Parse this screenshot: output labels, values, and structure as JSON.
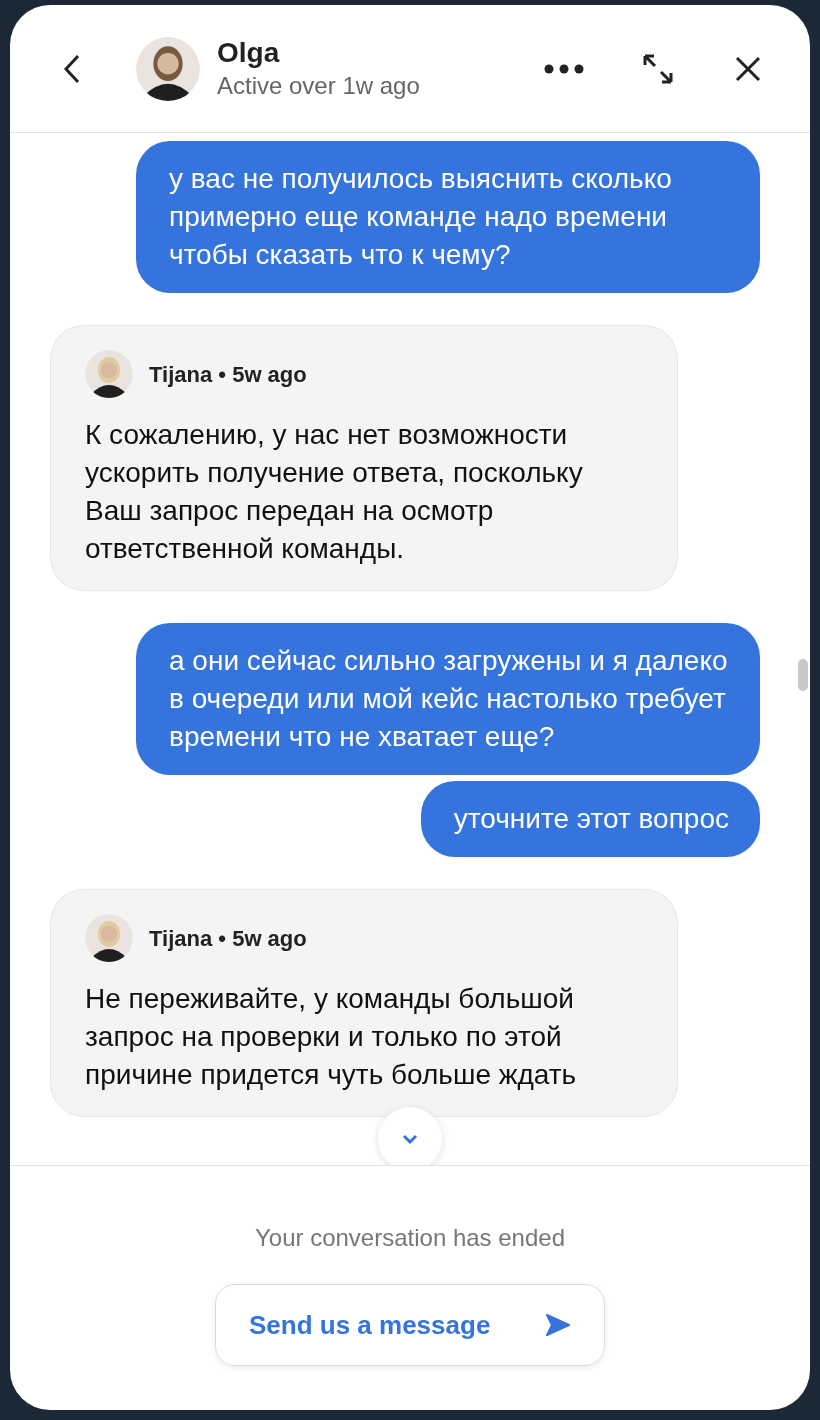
{
  "header": {
    "name": "Olga",
    "status": "Active over 1w ago"
  },
  "messages": [
    {
      "kind": "outgoing",
      "text": "у вас не получилось выяснить сколько примерно еще команде надо времени чтобы сказать что к чему?"
    },
    {
      "kind": "incoming",
      "author": "Tijana",
      "separator": "•",
      "time": "5w ago",
      "text": "К сожалению, у нас нет возможности ускорить получение ответа, поскольку Ваш запрос передан на осмотр ответственной команды."
    },
    {
      "kind": "outgoing",
      "text": "а они сейчас сильно загружены и я далеко в очереди или мой кейс настолько требует времени что не хватает еще?"
    },
    {
      "kind": "outgoing",
      "text": "уточните этот вопрос"
    },
    {
      "kind": "incoming",
      "author": "Tijana",
      "separator": "•",
      "time": "5w ago",
      "text": "Не переживайте, у команды большой запрос на проверки и только по этой причине придется чуть больше ждать"
    }
  ],
  "footer": {
    "notice": "Your conversation has ended",
    "button": "Send us a message"
  }
}
